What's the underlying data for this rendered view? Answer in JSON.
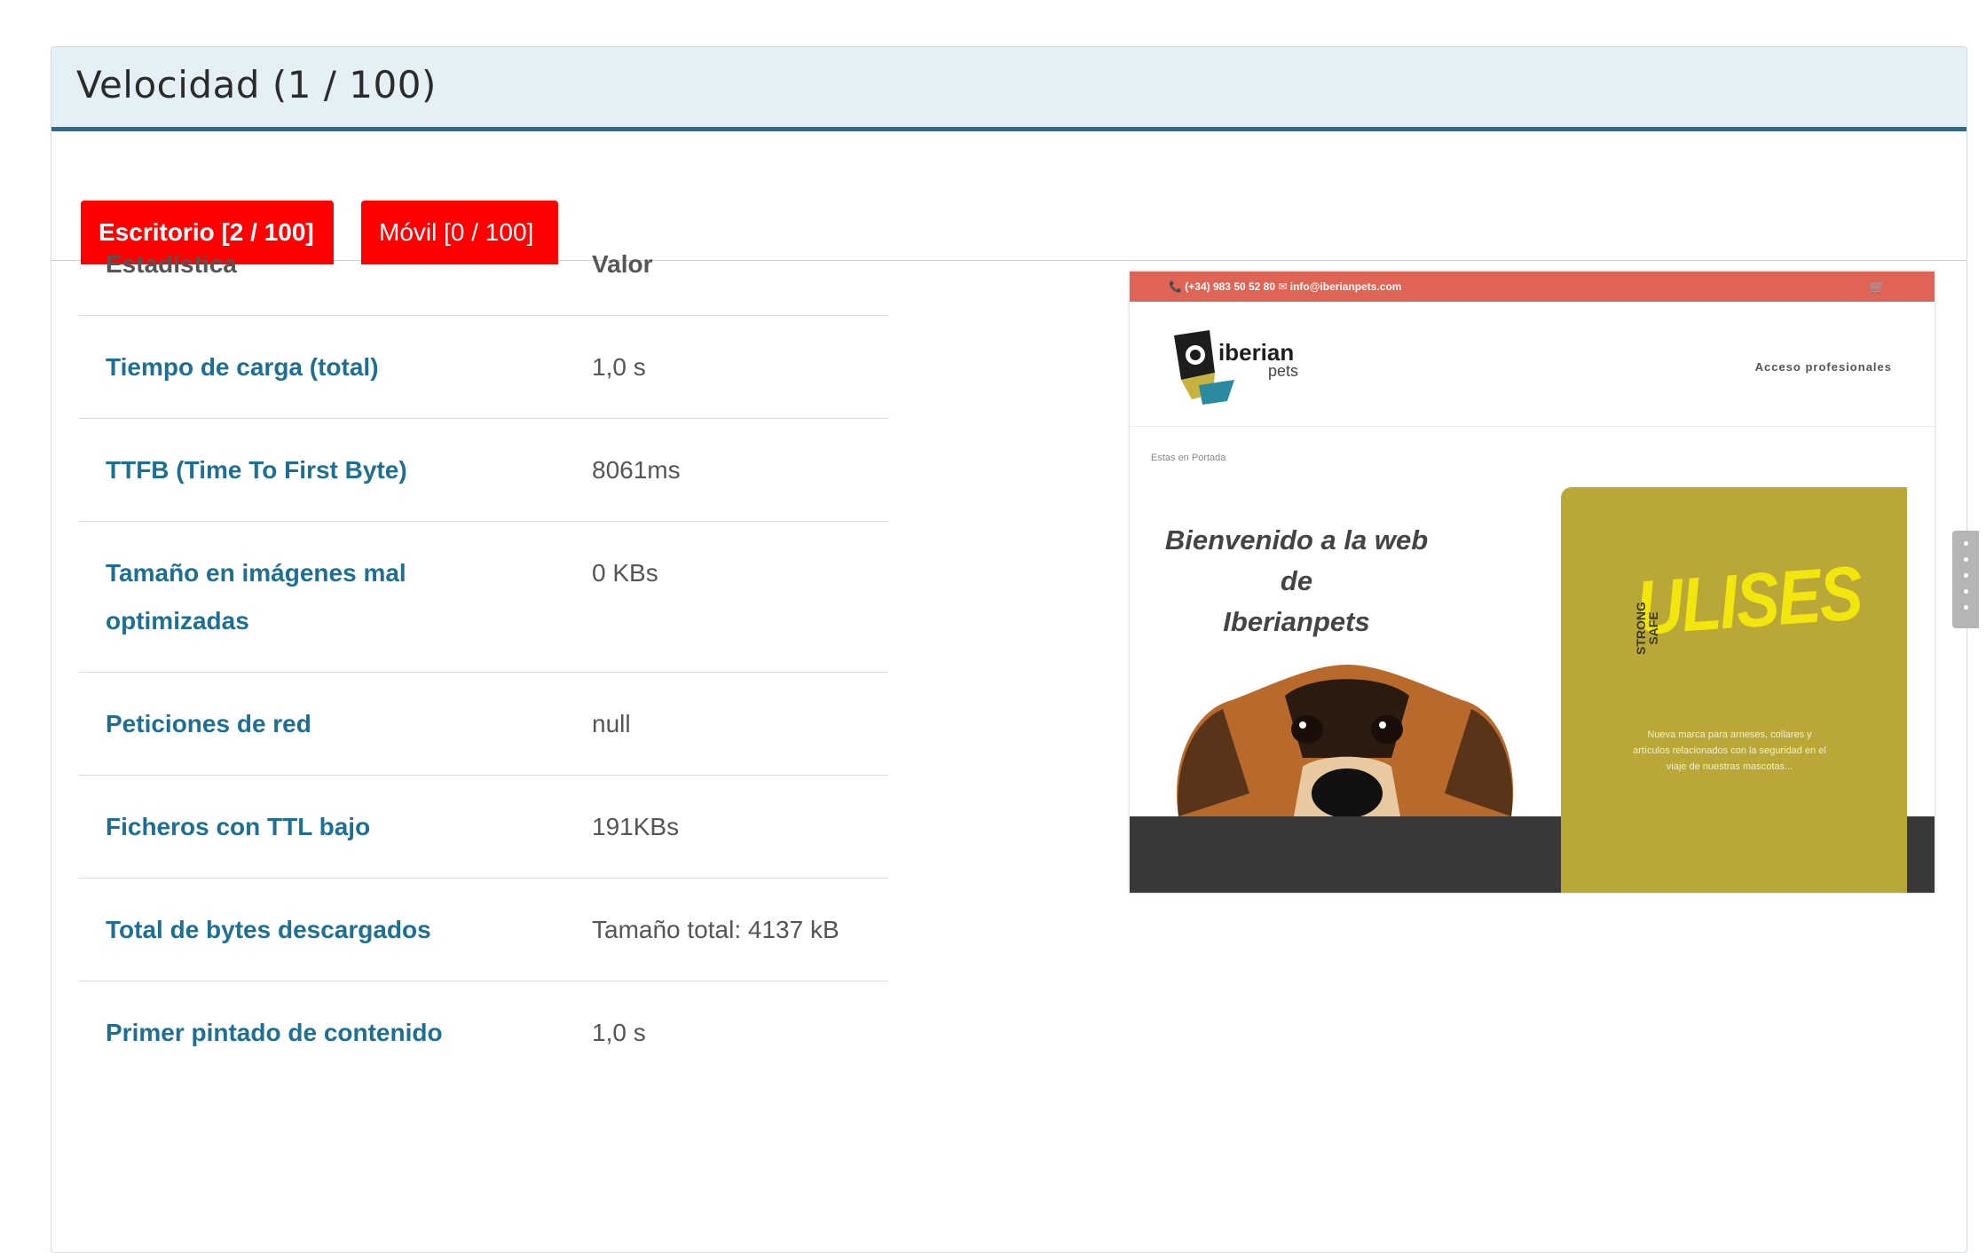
{
  "panel": {
    "title": "Velocidad (1 / 100)"
  },
  "tabs": [
    {
      "label": "Escritorio [2 / 100]",
      "active": true
    },
    {
      "label": "Móvil [0 / 100]",
      "active": false
    }
  ],
  "table": {
    "headers": {
      "stat": "Estadística",
      "value": "Valor"
    },
    "rows": [
      {
        "label": "Tiempo de carga (total)",
        "value": "1,0 s"
      },
      {
        "label": "TTFB (Time To First Byte)",
        "value": "8061ms"
      },
      {
        "label": "Tamaño en imágenes mal optimizadas",
        "value": "0 KBs"
      },
      {
        "label": "Peticiones de red",
        "value": "null"
      },
      {
        "label": "Ficheros con TTL bajo",
        "value": "191KBs"
      },
      {
        "label": "Total de bytes descargados",
        "value": "Tamaño total: 4137 kB"
      },
      {
        "label": "Primer pintado de contenido",
        "value": "1,0 s"
      }
    ]
  },
  "preview": {
    "contact": "📞 (+34) 983 50 52 80   ✉ info@iberianpets.com",
    "brand_main": "iberian",
    "brand_sub": "pets",
    "acceso": "Acceso profesionales",
    "breadcrumb": "Estas en Portada",
    "welcome_line1": "Bienvenido a la web de",
    "welcome_line2": "Iberianpets",
    "banner_title": "ULISES",
    "banner_tag": "STRONG SAFE",
    "banner_desc": "Nueva marca para arneses, collares y artículos relacionados con la seguridad en el viaje de nuestras mascotas..."
  },
  "colors": {
    "tab_bg": "#fe0000",
    "link": "#1f6f93",
    "header_bg": "#e4f0f6",
    "header_border": "#2a6d8f"
  }
}
